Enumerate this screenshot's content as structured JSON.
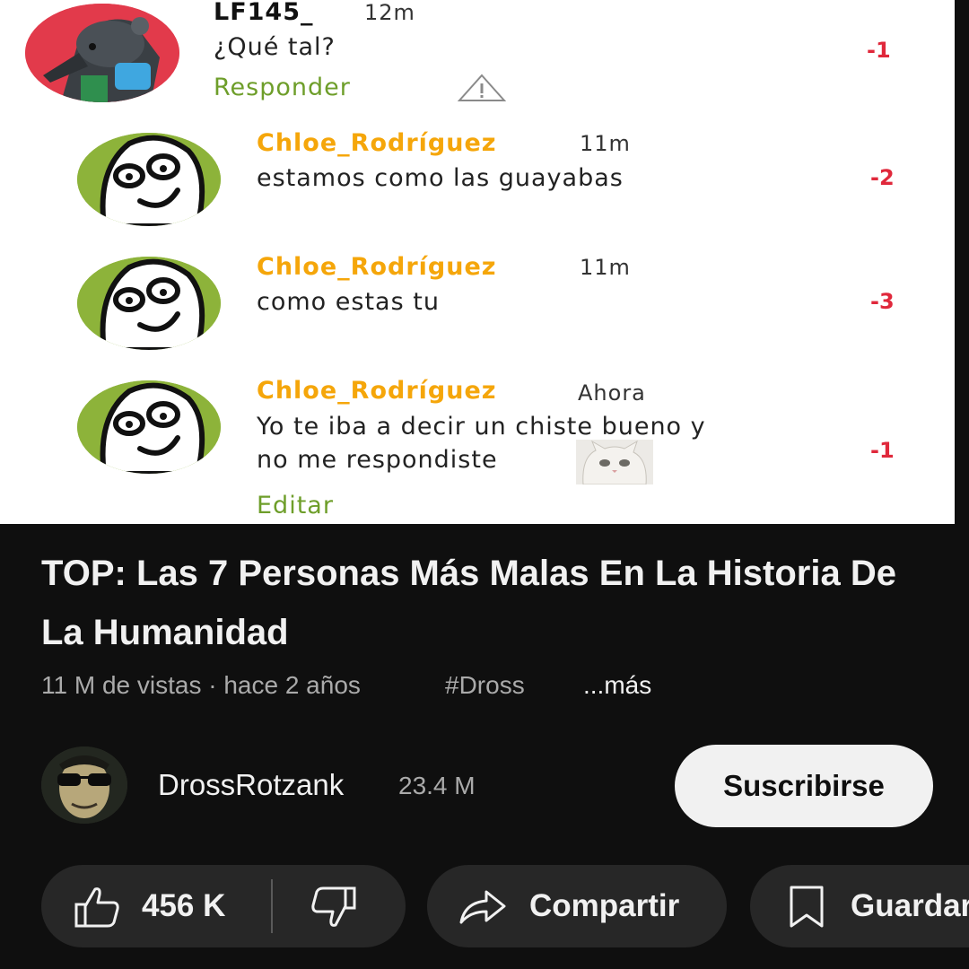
{
  "comments": [
    {
      "author": "LF145_",
      "time": "12m",
      "text": "¿Qué tal?",
      "score": "-1",
      "action": "Responder"
    },
    {
      "author": "Chloe_Rodríguez",
      "time": "11m",
      "text": "estamos como las guayabas",
      "score": "-2"
    },
    {
      "author": "Chloe_Rodríguez",
      "time": "11m",
      "text": "como estas tu",
      "score": "-3"
    },
    {
      "author": "Chloe_Rodríguez",
      "time": "Ahora",
      "text_line1": "Yo te iba a decir un chiste bueno y",
      "text_line2": "no me respondiste",
      "score": "-1",
      "action": "Editar"
    }
  ],
  "video": {
    "title": "TOP: Las 7 Personas Más Malas En La Historia De La Humanidad",
    "views": "11 M de vistas · hace 2 años",
    "hashtag": "#Dross",
    "more": "...más"
  },
  "channel": {
    "name": "DrossRotzank",
    "subscribers": "23.4 M",
    "subscribe_label": "Suscribirse"
  },
  "actions": {
    "likes": "456 K",
    "share_label": "Compartir",
    "save_label": "Guardar"
  },
  "colors": {
    "username_orange": "#f5a60a",
    "action_green": "#6e9e2a",
    "score_red": "#e0283b",
    "avatar_green": "#8db33a",
    "dark_bg": "#0f0f0f",
    "pill_bg": "#272727"
  }
}
